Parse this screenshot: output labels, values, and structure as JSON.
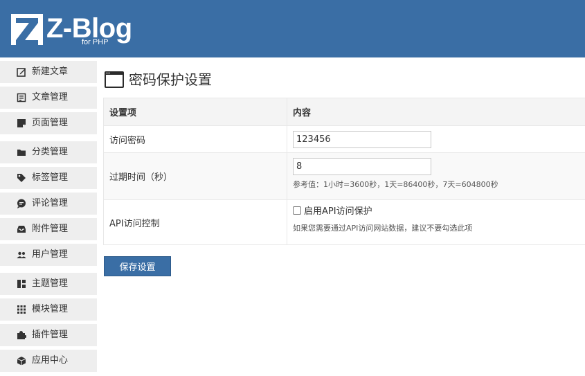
{
  "brand": {
    "logo_letter": "Z",
    "name": "Z-Blog",
    "sub": "for PHP",
    "header_color": "#3a6ea5"
  },
  "sidebar": {
    "items": [
      {
        "label": "新建文章",
        "icon": "edit-icon"
      },
      {
        "label": "文章管理",
        "icon": "article-list-icon"
      },
      {
        "label": "页面管理",
        "icon": "page-icon"
      },
      {
        "label": "分类管理",
        "icon": "folder-icon"
      },
      {
        "label": "标签管理",
        "icon": "tag-icon"
      },
      {
        "label": "评论管理",
        "icon": "comment-icon"
      },
      {
        "label": "附件管理",
        "icon": "inbox-icon"
      },
      {
        "label": "用户管理",
        "icon": "users-icon"
      },
      {
        "label": "主题管理",
        "icon": "layout-icon"
      },
      {
        "label": "模块管理",
        "icon": "grid-icon"
      },
      {
        "label": "插件管理",
        "icon": "puzzle-icon"
      },
      {
        "label": "应用中心",
        "icon": "cube-icon"
      }
    ]
  },
  "page": {
    "title": "密码保护设置",
    "title_icon": "window-icon"
  },
  "table": {
    "headers": [
      "设置项",
      "内容"
    ],
    "rows": {
      "password": {
        "label": "访问密码",
        "value": "123456"
      },
      "expire": {
        "label": "过期时间（秒）",
        "value": "8",
        "hint": "参考值：1小时=3600秒，1天=86400秒，7天=604800秒"
      },
      "api": {
        "label": "API访问控制",
        "checkbox_label": "启用API访问保护",
        "checked": false,
        "hint": "如果您需要通过API访问网站数据，建议不要勾选此项"
      }
    }
  },
  "actions": {
    "save_label": "保存设置"
  }
}
